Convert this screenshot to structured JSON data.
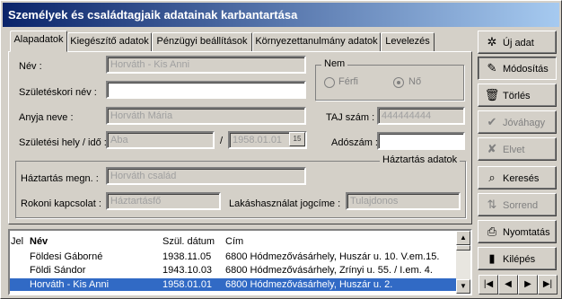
{
  "window": {
    "title": "Személyek és családtagjaik adatainak karbantartása"
  },
  "tabs": [
    "Alapadatok",
    "Kiegészítő adatok",
    "Pénzügyi beállítások",
    "Környezettanulmány adatok",
    "Levelezés"
  ],
  "form": {
    "nev_label": "Név :",
    "nev_value": "Horváth  - Kis Anni",
    "szuleteskori_label": "Születéskori név :",
    "szuleteskori_value": "",
    "anyja_label": "Anyja neve :",
    "anyja_value": "Horváth Mária",
    "szuletesi_label": "Születési hely / idő :",
    "szuletesi_hely": "Aba",
    "date_sep": "/",
    "szuletesi_ido": "1958.01.01",
    "date_button": "15",
    "nem_title": "Nem",
    "ferfi_label": "Férfi",
    "no_label": "Nő",
    "taj_label": "TAJ szám :",
    "taj_value": "444444444",
    "ado_label": "Adószám :",
    "ado_value": "",
    "haztartas_title": "Háztartás adatok",
    "haztartas_megn_label": "Háztartás megn. :",
    "haztartas_megn_value": "Horváth család",
    "rokoni_label": "Rokoni kapcsolat :",
    "rokoni_value": "Háztartásfő",
    "lakas_label": "Lakáshasználat jogcíme :",
    "lakas_value": "Tulajdonos"
  },
  "buttons": {
    "uj": "Új adat",
    "modositas": "Módosítás",
    "torles": "Törlés",
    "jovahagy": "Jóváhagy",
    "elvet": "Elvet",
    "kereses": "Keresés",
    "sorrend": "Sorrend",
    "nyomtatas": "Nyomtatás",
    "kilepes": "Kilépés"
  },
  "grid": {
    "headers": {
      "jel": "Jel",
      "nev": "Név",
      "szul": "Szül. dátum",
      "cim": "Cím"
    },
    "rows": [
      {
        "nev": "Földesi Gáborné",
        "szul": "1938.11.05",
        "cim": "6800 Hódmezővásárhely, Huszár u. 10. V.em.15."
      },
      {
        "nev": "Földi Sándor",
        "szul": "1943.10.03",
        "cim": "6800 Hódmezővásárhely, Zrínyi u. 55. / I.em.  4."
      },
      {
        "nev": "Horváth  - Kis Anni",
        "szul": "1958.01.01",
        "cim": "6800 Hódmezővásárhely, Huszár u. 2."
      }
    ]
  },
  "nav": [
    "|◀",
    "◀",
    "▶",
    "▶|"
  ]
}
